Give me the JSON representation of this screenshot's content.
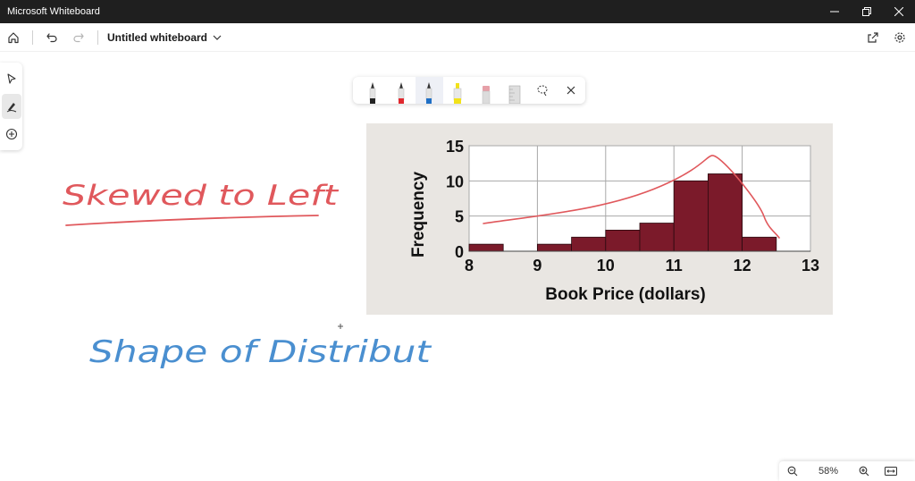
{
  "window": {
    "title": "Microsoft Whiteboard"
  },
  "appbar": {
    "board_title": "Untitled whiteboard"
  },
  "palette": {
    "pens": [
      {
        "name": "black-pen",
        "color": "#222222"
      },
      {
        "name": "red-pen",
        "color": "#e0282e"
      },
      {
        "name": "blue-pen",
        "color": "#1f6fc5"
      },
      {
        "name": "yellow-highlighter",
        "color": "#f2e21a"
      },
      {
        "name": "eraser",
        "color": "#e6a0a8"
      },
      {
        "name": "ruler",
        "color": "#b8b8b8"
      }
    ],
    "selected": "blue-pen"
  },
  "ink": {
    "red_text": "Skewed to Left",
    "blue_text": "Shape of Distribut",
    "red_color": "#e0585c",
    "blue_color": "#4a8fd0"
  },
  "chart_data": {
    "type": "bar",
    "xlabel": "Book Price (dollars)",
    "ylabel": "Frequency",
    "xticks": [
      "8",
      "9",
      "10",
      "11",
      "12",
      "13"
    ],
    "yticks": [
      "0",
      "5",
      "10",
      "15"
    ],
    "xlim": [
      8,
      13
    ],
    "ylim": [
      0,
      15
    ],
    "bin_width": 0.5,
    "bins": [
      {
        "x0": 8.0,
        "x1": 8.5,
        "value": 1
      },
      {
        "x0": 8.5,
        "x1": 9.0,
        "value": 0
      },
      {
        "x0": 9.0,
        "x1": 9.5,
        "value": 1
      },
      {
        "x0": 9.5,
        "x1": 10.0,
        "value": 2
      },
      {
        "x0": 10.0,
        "x1": 10.5,
        "value": 3
      },
      {
        "x0": 10.5,
        "x1": 11.0,
        "value": 4
      },
      {
        "x0": 11.0,
        "x1": 11.5,
        "value": 10
      },
      {
        "x0": 11.5,
        "x1": 12.0,
        "value": 11
      },
      {
        "x0": 12.0,
        "x1": 12.5,
        "value": 2
      }
    ],
    "bar_color": "#7b1a2a",
    "grid": true
  },
  "zoom": {
    "level": "58%"
  }
}
